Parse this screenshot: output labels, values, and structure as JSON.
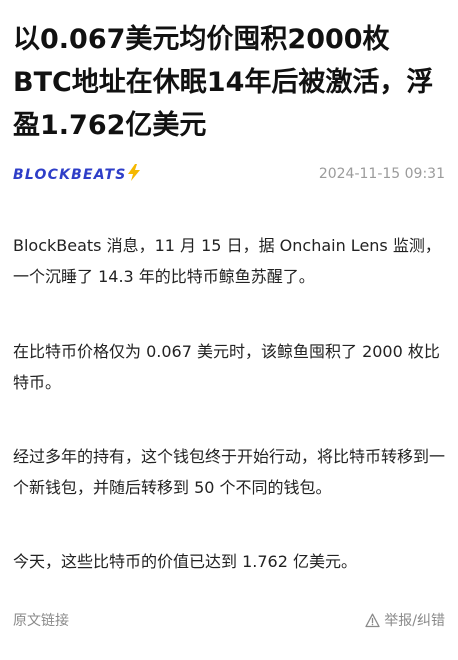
{
  "article": {
    "title": "以0.067美元均价囤积2000枚BTC地址在休眠14年后被激活，浮盈1.762亿美元",
    "source": {
      "name": "BLOCKBEATS",
      "icon": "lightning-bolt-icon",
      "brand_color": "#2e3ec8",
      "bolt_color": "#f5b800"
    },
    "date": "2024-11-15 09:31",
    "paragraphs": [
      "BlockBeats 消息，11 月 15 日，据 Onchain Lens 监测，一个沉睡了 14.3 年的比特币鲸鱼苏醒了。",
      "在比特币价格仅为 0.067 美元时，该鲸鱼囤积了 2000 枚比特币。",
      "经过多年的持有，这个钱包终于开始行动，将比特币转移到一个新钱包，并随后转移到 50 个不同的钱包。",
      "今天，这些比特币的价值已达到 1.762 亿美元。"
    ]
  },
  "footer": {
    "source_link_label": "原文链接",
    "report_label": "举报/纠错",
    "report_icon": "warning-triangle-icon"
  }
}
